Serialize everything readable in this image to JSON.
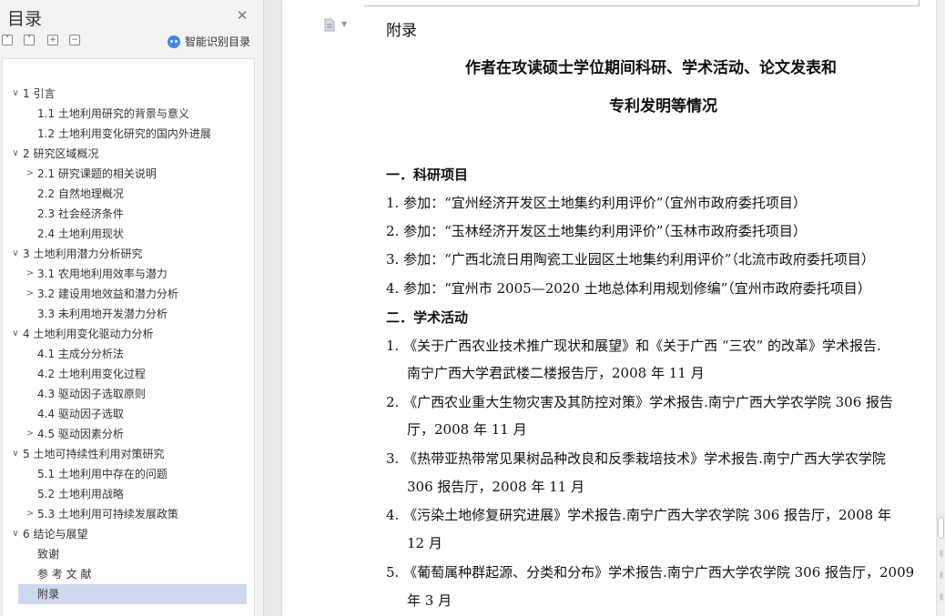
{
  "sidebar": {
    "title": "目录",
    "smart_label": "智能识别目录",
    "toc": [
      {
        "label": "1 引言",
        "chev": "∨"
      },
      {
        "label": "1.1 土地利用研究的背景与意义",
        "chev": ""
      },
      {
        "label": "1.2 土地利用变化研究的国内外进展",
        "chev": ""
      },
      {
        "label": "2 研究区域概况",
        "chev": "∨"
      },
      {
        "label": "2.1 研究课题的相关说明",
        "chev": ">"
      },
      {
        "label": "2.2 自然地理概况",
        "chev": ""
      },
      {
        "label": "2.3 社会经济条件",
        "chev": ""
      },
      {
        "label": "2.4 土地利用现状",
        "chev": ""
      },
      {
        "label": "3 土地利用潜力分析研究",
        "chev": "∨"
      },
      {
        "label": "3.1 农用地利用效率与潜力",
        "chev": ">"
      },
      {
        "label": "3.2 建设用地效益和潜力分析",
        "chev": ">"
      },
      {
        "label": "3.3 未利用地开发潜力分析",
        "chev": ""
      },
      {
        "label": "4 土地利用变化驱动力分析",
        "chev": "∨"
      },
      {
        "label": "4.1 主成分分析法",
        "chev": ""
      },
      {
        "label": "4.2 土地利用变化过程",
        "chev": ""
      },
      {
        "label": "4.3 驱动因子选取原则",
        "chev": ""
      },
      {
        "label": "4.4 驱动因子选取",
        "chev": ""
      },
      {
        "label": "4.5 驱动因素分析",
        "chev": ">"
      },
      {
        "label": "5 土地可持续性利用对策研究",
        "chev": "∨"
      },
      {
        "label": "5.1 土地利用中存在的问题",
        "chev": ""
      },
      {
        "label": "5.2 土地利用战略",
        "chev": ""
      },
      {
        "label": "5.3 土地利用可持续发展政策",
        "chev": ">"
      },
      {
        "label": "6 结论与展望",
        "chev": "∨"
      },
      {
        "label": "致谢",
        "chev": ""
      },
      {
        "label": "参 考 文 献",
        "chev": ""
      },
      {
        "label": "附录",
        "chev": ""
      }
    ]
  },
  "document": {
    "appendix": "附录",
    "title_line1": "作者在攻读硕士学位期间科研、学术活动、论文发表和",
    "title_line2": "专利发明等情况",
    "sec1": "一．科研项目",
    "lines": [
      "1.  参加：“宜州经济开发区土地集约利用评价”（宜州市政府委托项目）",
      "2.  参加：“玉林经济开发区土地集约利用评价”（玉林市政府委托项目）",
      "3.  参加：“广西北流日用陶瓷工业园区土地集约利用评价”（北流市政府委托项目）",
      "4.  参加：“宜州市 2005—2020 土地总体利用规划修编”（宜州市政府委托项目）",
      "二．学术活动",
      "1.  《关于广西农业技术推广现状和展望》和《关于广西 “三农” 的改革》学术报告.",
      "南宁广西大学君武楼二楼报告厅，2008 年 11 月",
      "2.  《广西农业重大生物灾害及其防控对策》学术报告.南宁广西大学农学院 306 报告",
      "厅，2008 年 11 月",
      "3.  《热带亚热带常见果树品种改良和反季栽培技术》学术报告.南宁广西大学农学院",
      "306 报告厅，2008 年 11 月",
      "4.  《污染土地修复研究进展》学术报告.南宁广西大学农学院 306 报告厅，2008 年",
      "12 月",
      "5.  《葡萄属种群起源、分类和分布》学术报告.南宁广西大学农学院 306 报告厅，2009",
      "年 3 月"
    ]
  }
}
